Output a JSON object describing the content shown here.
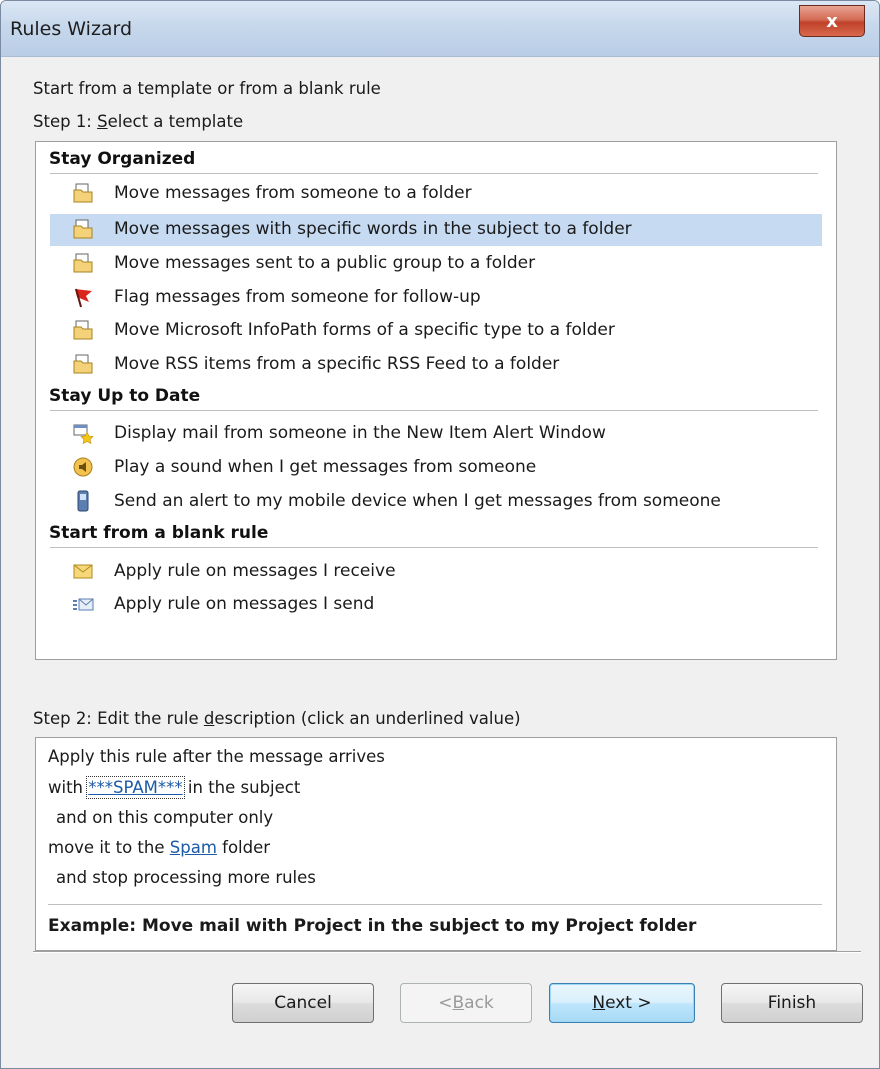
{
  "window": {
    "title": "Rules Wizard",
    "close_label": "x"
  },
  "intro": "Start from a template or from a blank rule",
  "step1": {
    "prefix": "Step 1: ",
    "accel": "S",
    "rest": "elect a template"
  },
  "templates": {
    "sections": [
      {
        "title": "Stay Organized",
        "items": [
          {
            "label": "Move messages from someone to a folder",
            "icon": "folder-move-icon",
            "selected": false
          },
          {
            "label": "Move messages with specific words in the subject to a folder",
            "icon": "folder-move-icon",
            "selected": true
          },
          {
            "label": "Move messages sent to a public group to a folder",
            "icon": "folder-move-icon",
            "selected": false
          },
          {
            "label": "Flag messages from someone for follow-up",
            "icon": "red-flag-icon",
            "selected": false
          },
          {
            "label": "Move Microsoft InfoPath forms of a specific type to a folder",
            "icon": "folder-move-icon",
            "selected": false
          },
          {
            "label": "Move RSS items from a specific RSS Feed to a folder",
            "icon": "folder-move-icon",
            "selected": false
          }
        ]
      },
      {
        "title": "Stay Up to Date",
        "items": [
          {
            "label": "Display mail from someone in the New Item Alert Window",
            "icon": "alert-window-icon",
            "selected": false
          },
          {
            "label": "Play a sound when I get messages from someone",
            "icon": "speaker-icon",
            "selected": false
          },
          {
            "label": "Send an alert to my mobile device when I get messages from someone",
            "icon": "mobile-device-icon",
            "selected": false
          }
        ]
      },
      {
        "title": "Start from a blank rule",
        "items": [
          {
            "label": "Apply rule on messages I receive",
            "icon": "envelope-icon",
            "selected": false
          },
          {
            "label": "Apply rule on messages I send",
            "icon": "send-message-icon",
            "selected": false
          }
        ]
      }
    ]
  },
  "step2": {
    "prefix": "Step 2: Edit the rule ",
    "accel": "d",
    "rest": "escription (click an underlined value)"
  },
  "description": {
    "line1": "Apply this rule after the message arrives",
    "line2_pre": "with ",
    "line2_link": "***SPAM***",
    "line2_post": " in the subject",
    "line3": "and on this computer only",
    "line4_pre": "move it to the ",
    "line4_link": "Spam",
    "line4_post": " folder",
    "line5": "and stop processing more rules",
    "example": "Example: Move mail with Project in the subject to my Project folder"
  },
  "buttons": {
    "cancel": "Cancel",
    "back_pre": "< ",
    "back_accel": "B",
    "back_rest": "ack",
    "next_accel": "N",
    "next_rest": "ext >",
    "finish": "Finish"
  },
  "colors": {
    "selection": "#c6daf2",
    "link": "#1a5aa6",
    "close_button": "#c7432c"
  }
}
